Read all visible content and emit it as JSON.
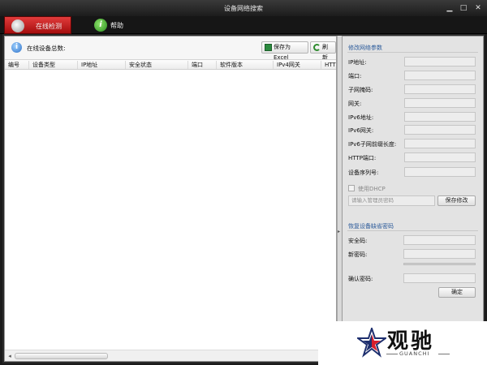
{
  "window": {
    "title": "设备网络搜索",
    "minimize": "▁",
    "restore": "□",
    "close": "✕"
  },
  "tabs": [
    {
      "label": "在线检测"
    },
    {
      "label": "帮助"
    }
  ],
  "toolbar": {
    "online_count_label": "在线设备总数:",
    "save_excel_label": "保存为Excel",
    "refresh_label": "刷新"
  },
  "table": {
    "columns": [
      "编号",
      "设备类型",
      "IP地址",
      "安全状态",
      "端口",
      "软件版本",
      "IPv4网关",
      "HTT"
    ],
    "rows": []
  },
  "modify_params": {
    "title": "修改网络参数",
    "fields": [
      {
        "label": "IP地址:",
        "value": ""
      },
      {
        "label": "端口:",
        "value": ""
      },
      {
        "label": "子网掩码:",
        "value": ""
      },
      {
        "label": "网关:",
        "value": ""
      },
      {
        "label": "IPv6地址:",
        "value": ""
      },
      {
        "label": "IPv6网关:",
        "value": ""
      },
      {
        "label": "IPv6子网前缀长度:",
        "value": ""
      },
      {
        "label": "HTTP端口:",
        "value": ""
      },
      {
        "label": "设备序列号:",
        "value": ""
      }
    ],
    "dhcp_label": "使用DHCP",
    "dhcp_checked": false,
    "admin_password_placeholder": "请输入管理员密码",
    "save_button": "保存修改"
  },
  "restore_password": {
    "title": "恢复设备缺省密码",
    "security_code_label": "安全码:",
    "new_password_label": "新密码:",
    "confirm_password_label": "确认密码:",
    "confirm_button": "确定"
  },
  "watermark": {
    "name_cn": "观驰",
    "name_en": "GUANCHI"
  },
  "colors": {
    "active_tab": "#c41c1c",
    "section_title": "#2b5a9a"
  }
}
